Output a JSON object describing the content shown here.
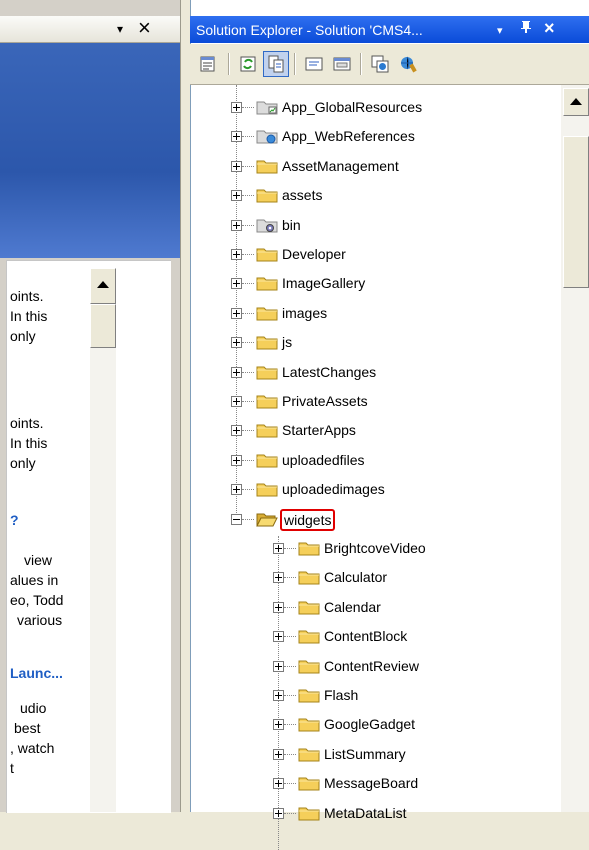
{
  "left_pane": {
    "close_glyph": "×",
    "dropdown_glyph": "▾",
    "text_lines": [
      "oints.",
      "In this",
      "only",
      "oints.",
      "In this",
      "only",
      "?",
      "view",
      "alues in",
      "eo, Todd",
      "various",
      "Launc...",
      "udio",
      "best",
      ", watch",
      "t"
    ]
  },
  "solution_explorer": {
    "title": "Solution Explorer - Solution 'CMS4...",
    "dropdown_glyph": "▾",
    "pin_glyph": "ᵖ",
    "close_glyph": "×",
    "toolbar_buttons": [
      {
        "icon": "properties-icon"
      },
      {
        "icon": "refresh-icon"
      },
      {
        "icon": "show-all-files-icon",
        "pressed": true
      },
      {
        "icon": "view-code-icon"
      },
      {
        "icon": "view-designer-icon"
      },
      {
        "icon": "copy-website-icon"
      },
      {
        "icon": "asp-net-configuration-icon"
      }
    ],
    "tree": [
      {
        "label": "App_GlobalResources",
        "icon": "global-resources-folder-icon",
        "expanded": false
      },
      {
        "label": "App_WebReferences",
        "icon": "web-references-folder-icon",
        "expanded": false
      },
      {
        "label": "AssetManagement",
        "icon": "folder-icon",
        "expanded": false
      },
      {
        "label": "assets",
        "icon": "folder-icon",
        "expanded": false
      },
      {
        "label": "bin",
        "icon": "bin-folder-icon",
        "expanded": false
      },
      {
        "label": "Developer",
        "icon": "folder-icon",
        "expanded": false
      },
      {
        "label": "ImageGallery",
        "icon": "folder-icon",
        "expanded": false
      },
      {
        "label": "images",
        "icon": "folder-icon",
        "expanded": false
      },
      {
        "label": "js",
        "icon": "folder-icon",
        "expanded": false
      },
      {
        "label": "LatestChanges",
        "icon": "folder-icon",
        "expanded": false
      },
      {
        "label": "PrivateAssets",
        "icon": "folder-icon",
        "expanded": false
      },
      {
        "label": "StarterApps",
        "icon": "folder-icon",
        "expanded": false
      },
      {
        "label": "uploadedfiles",
        "icon": "folder-icon",
        "expanded": false
      },
      {
        "label": "uploadedimages",
        "icon": "folder-icon",
        "expanded": false
      },
      {
        "label": "widgets",
        "icon": "open-folder-icon",
        "expanded": true,
        "selected": true
      },
      {
        "label": "BrightcoveVideo",
        "icon": "folder-icon",
        "expanded": false,
        "child": true
      },
      {
        "label": "Calculator",
        "icon": "folder-icon",
        "expanded": false,
        "child": true
      },
      {
        "label": "Calendar",
        "icon": "folder-icon",
        "expanded": false,
        "child": true
      },
      {
        "label": "ContentBlock",
        "icon": "folder-icon",
        "expanded": false,
        "child": true
      },
      {
        "label": "ContentReview",
        "icon": "folder-icon",
        "expanded": false,
        "child": true
      },
      {
        "label": "Flash",
        "icon": "folder-icon",
        "expanded": false,
        "child": true
      },
      {
        "label": "GoogleGadget",
        "icon": "folder-icon",
        "expanded": false,
        "child": true
      },
      {
        "label": "ListSummary",
        "icon": "folder-icon",
        "expanded": false,
        "child": true
      },
      {
        "label": "MessageBoard",
        "icon": "folder-icon",
        "expanded": false,
        "child": true
      },
      {
        "label": "MetaDataList",
        "icon": "folder-icon",
        "expanded": false,
        "child": true
      }
    ]
  },
  "colors": {
    "titlebar_blue": "#0a4bd8",
    "selection_outline": "#e00000",
    "folder_yellow": "#f5cf5a",
    "link_blue": "#1f5ec4"
  }
}
